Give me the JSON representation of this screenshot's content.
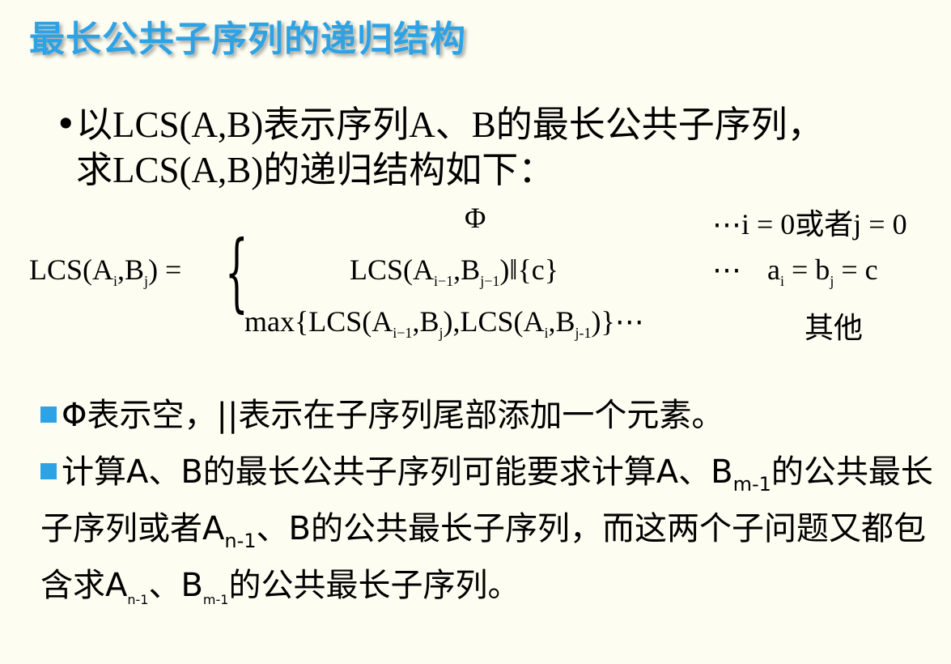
{
  "slide": {
    "title": "最长公共子序列的递归结构",
    "intro_line1": "以LCS(A,B)表示序列A、B的最长公共子序列，",
    "intro_line2": "求LCS(A,B)的递归结构如下：",
    "bullet_marker": "•",
    "formula": {
      "lhs": "LCS(A",
      "lhs_sub_i": "i",
      "lhs_comma": ",B",
      "lhs_sub_j": "j",
      "lhs_end": ") =",
      "case1_expr": "Φ",
      "case1_cond": "⋯i = 0或者j = 0",
      "case2_expr_a": "LCS(A",
      "case2_sub_a": "i−1",
      "case2_expr_b": ",B",
      "case2_sub_b": "j−1",
      "case2_expr_c": ")‖{c}",
      "case2_dots": "⋯",
      "case2_cond_a": "a",
      "case2_cond_sub_i": "i",
      "case2_cond_b": " = b",
      "case2_cond_sub_j": "j",
      "case2_cond_c": " = c",
      "case3_a": "max{LCS(A",
      "case3_sub1": "i−1",
      "case3_b": ",B",
      "case3_sub2": "j",
      "case3_c": "),LCS(A",
      "case3_sub3": "i",
      "case3_d": ",B",
      "case3_sub4": "j-1",
      "case3_e": ")}⋯",
      "case3_cond": "其他"
    },
    "note1": "Φ表示空，||表示在子序列尾部添加一个元素。",
    "note2_a": "计算A、B的最长公共子序列可能要求计算A、B",
    "note2_sub_m": "m-1",
    "note2_b": "的公共最长子序列或者A",
    "note2_sub_n": "n-1",
    "note2_c": "、B的公共最长子序列，而这两个子问题又都包含求A",
    "note2_sub_n2": "n-1",
    "note2_d": "、B",
    "note2_sub_m2": "m-1",
    "note2_e": "的公共最长子序列。"
  },
  "colors": {
    "accent": "#2da3e6",
    "background": "#fdfdf2"
  }
}
